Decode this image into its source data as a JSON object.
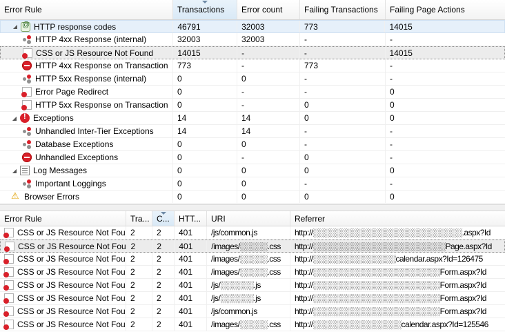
{
  "top_table": {
    "columns": [
      "Error Rule",
      "Transactions",
      "Error count",
      "Failing Transactions",
      "Failing Page Actions"
    ],
    "rows": [
      {
        "name": "HTTP response codes",
        "icon": "http-group-icon",
        "level": 0,
        "expand": "open",
        "transactions": "46791",
        "error_count": "32003",
        "failing_transactions": "773",
        "failing_page_actions": "14015"
      },
      {
        "name": "HTTP 4xx Response (internal)",
        "icon": "network-error-icon",
        "level": 1,
        "expand": "",
        "transactions": "32003",
        "error_count": "32003",
        "failing_transactions": "-",
        "failing_page_actions": "-"
      },
      {
        "name": "CSS or JS Resource Not Found",
        "icon": "page-error-icon",
        "level": 1,
        "expand": "",
        "transactions": "14015",
        "error_count": "-",
        "failing_transactions": "-",
        "failing_page_actions": "14015"
      },
      {
        "name": "HTTP 4xx Response on Transaction",
        "icon": "stop-icon",
        "level": 1,
        "expand": "",
        "transactions": "773",
        "error_count": "-",
        "failing_transactions": "773",
        "failing_page_actions": "-"
      },
      {
        "name": "HTTP 5xx Response (internal)",
        "icon": "network-error-icon",
        "level": 1,
        "expand": "",
        "transactions": "0",
        "error_count": "0",
        "failing_transactions": "-",
        "failing_page_actions": "-"
      },
      {
        "name": "Error Page Redirect",
        "icon": "page-error-icon",
        "level": 1,
        "expand": "",
        "transactions": "0",
        "error_count": "-",
        "failing_transactions": "-",
        "failing_page_actions": "0"
      },
      {
        "name": "HTTP 5xx Response on Transaction",
        "icon": "page-error-icon",
        "level": 1,
        "expand": "",
        "transactions": "0",
        "error_count": "-",
        "failing_transactions": "0",
        "failing_page_actions": "0"
      },
      {
        "name": "Exceptions",
        "icon": "exception-group-icon",
        "level": 0,
        "expand": "open",
        "transactions": "14",
        "error_count": "14",
        "failing_transactions": "0",
        "failing_page_actions": "0"
      },
      {
        "name": "Unhandled Inter-Tier Exceptions",
        "icon": "network-error-icon",
        "level": 1,
        "expand": "",
        "transactions": "14",
        "error_count": "14",
        "failing_transactions": "-",
        "failing_page_actions": "-"
      },
      {
        "name": "Database Exceptions",
        "icon": "network-error-icon",
        "level": 1,
        "expand": "",
        "transactions": "0",
        "error_count": "0",
        "failing_transactions": "-",
        "failing_page_actions": "-"
      },
      {
        "name": "Unhandled Exceptions",
        "icon": "stop-icon",
        "level": 1,
        "expand": "",
        "transactions": "0",
        "error_count": "-",
        "failing_transactions": "0",
        "failing_page_actions": "-"
      },
      {
        "name": "Log Messages",
        "icon": "log-icon",
        "level": 0,
        "expand": "open",
        "transactions": "0",
        "error_count": "0",
        "failing_transactions": "0",
        "failing_page_actions": "0"
      },
      {
        "name": "Important Loggings",
        "icon": "network-error-icon",
        "level": 1,
        "expand": "",
        "transactions": "0",
        "error_count": "0",
        "failing_transactions": "-",
        "failing_page_actions": "-"
      },
      {
        "name": "Browser Errors",
        "icon": "browser-error-icon",
        "level": 0,
        "expand": "",
        "transactions": "0",
        "error_count": "0",
        "failing_transactions": "0",
        "failing_page_actions": "0"
      }
    ]
  },
  "bottom_table": {
    "columns": [
      "Error Rule",
      "Tra...",
      "C...",
      "HTT...",
      "URI",
      "Referrer"
    ],
    "rows": [
      {
        "rule": "CSS or JS Resource Not Fou...",
        "tra": "2",
        "c": "2",
        "http": "401",
        "uri": "/js/common.js",
        "referrer": "http://░░░░░░░░░░░░░░░░░░░░░░░░░░░.aspx?Id"
      },
      {
        "rule": "CSS or JS Resource Not Fou...",
        "tra": "2",
        "c": "2",
        "http": "401",
        "uri": "/images/░░░░░.css",
        "referrer": "http://░░░░░░░░░░░░░░░░░░░░░░░░Page.aspx?Id"
      },
      {
        "rule": "CSS or JS Resource Not Fou...",
        "tra": "2",
        "c": "2",
        "http": "401",
        "uri": "/images/░░░░░.css",
        "referrer": "http://░░░░░░░░░░░░░░░calendar.aspx?Id=126475"
      },
      {
        "rule": "CSS or JS Resource Not Fou...",
        "tra": "2",
        "c": "2",
        "http": "401",
        "uri": "/images/░░░░░.css",
        "referrer": "http://░░░░░░░░░░░░░░░░░░░░░░░Form.aspx?Id"
      },
      {
        "rule": "CSS or JS Resource Not Fou...",
        "tra": "2",
        "c": "2",
        "http": "401",
        "uri": "/js/░░░░░░.js",
        "referrer": "http://░░░░░░░░░░░░░░░░░░░░░░░Form.aspx?Id"
      },
      {
        "rule": "CSS or JS Resource Not Fou...",
        "tra": "2",
        "c": "2",
        "http": "401",
        "uri": "/js/░░░░░░.js",
        "referrer": "http://░░░░░░░░░░░░░░░░░░░░░░░Form.aspx?Id"
      },
      {
        "rule": "CSS or JS Resource Not Fou...",
        "tra": "2",
        "c": "2",
        "http": "401",
        "uri": "/js/common.js",
        "referrer": "http://░░░░░░░░░░░░░░░░░░░░░░░Form.aspx?Id"
      },
      {
        "rule": "CSS or JS Resource Not Fou...",
        "tra": "2",
        "c": "2",
        "http": "401",
        "uri": "/images/░░░░░.css",
        "referrer": "http://░░░░░░░░░░░░░░░░calendar.aspx?Id=125546"
      }
    ]
  }
}
